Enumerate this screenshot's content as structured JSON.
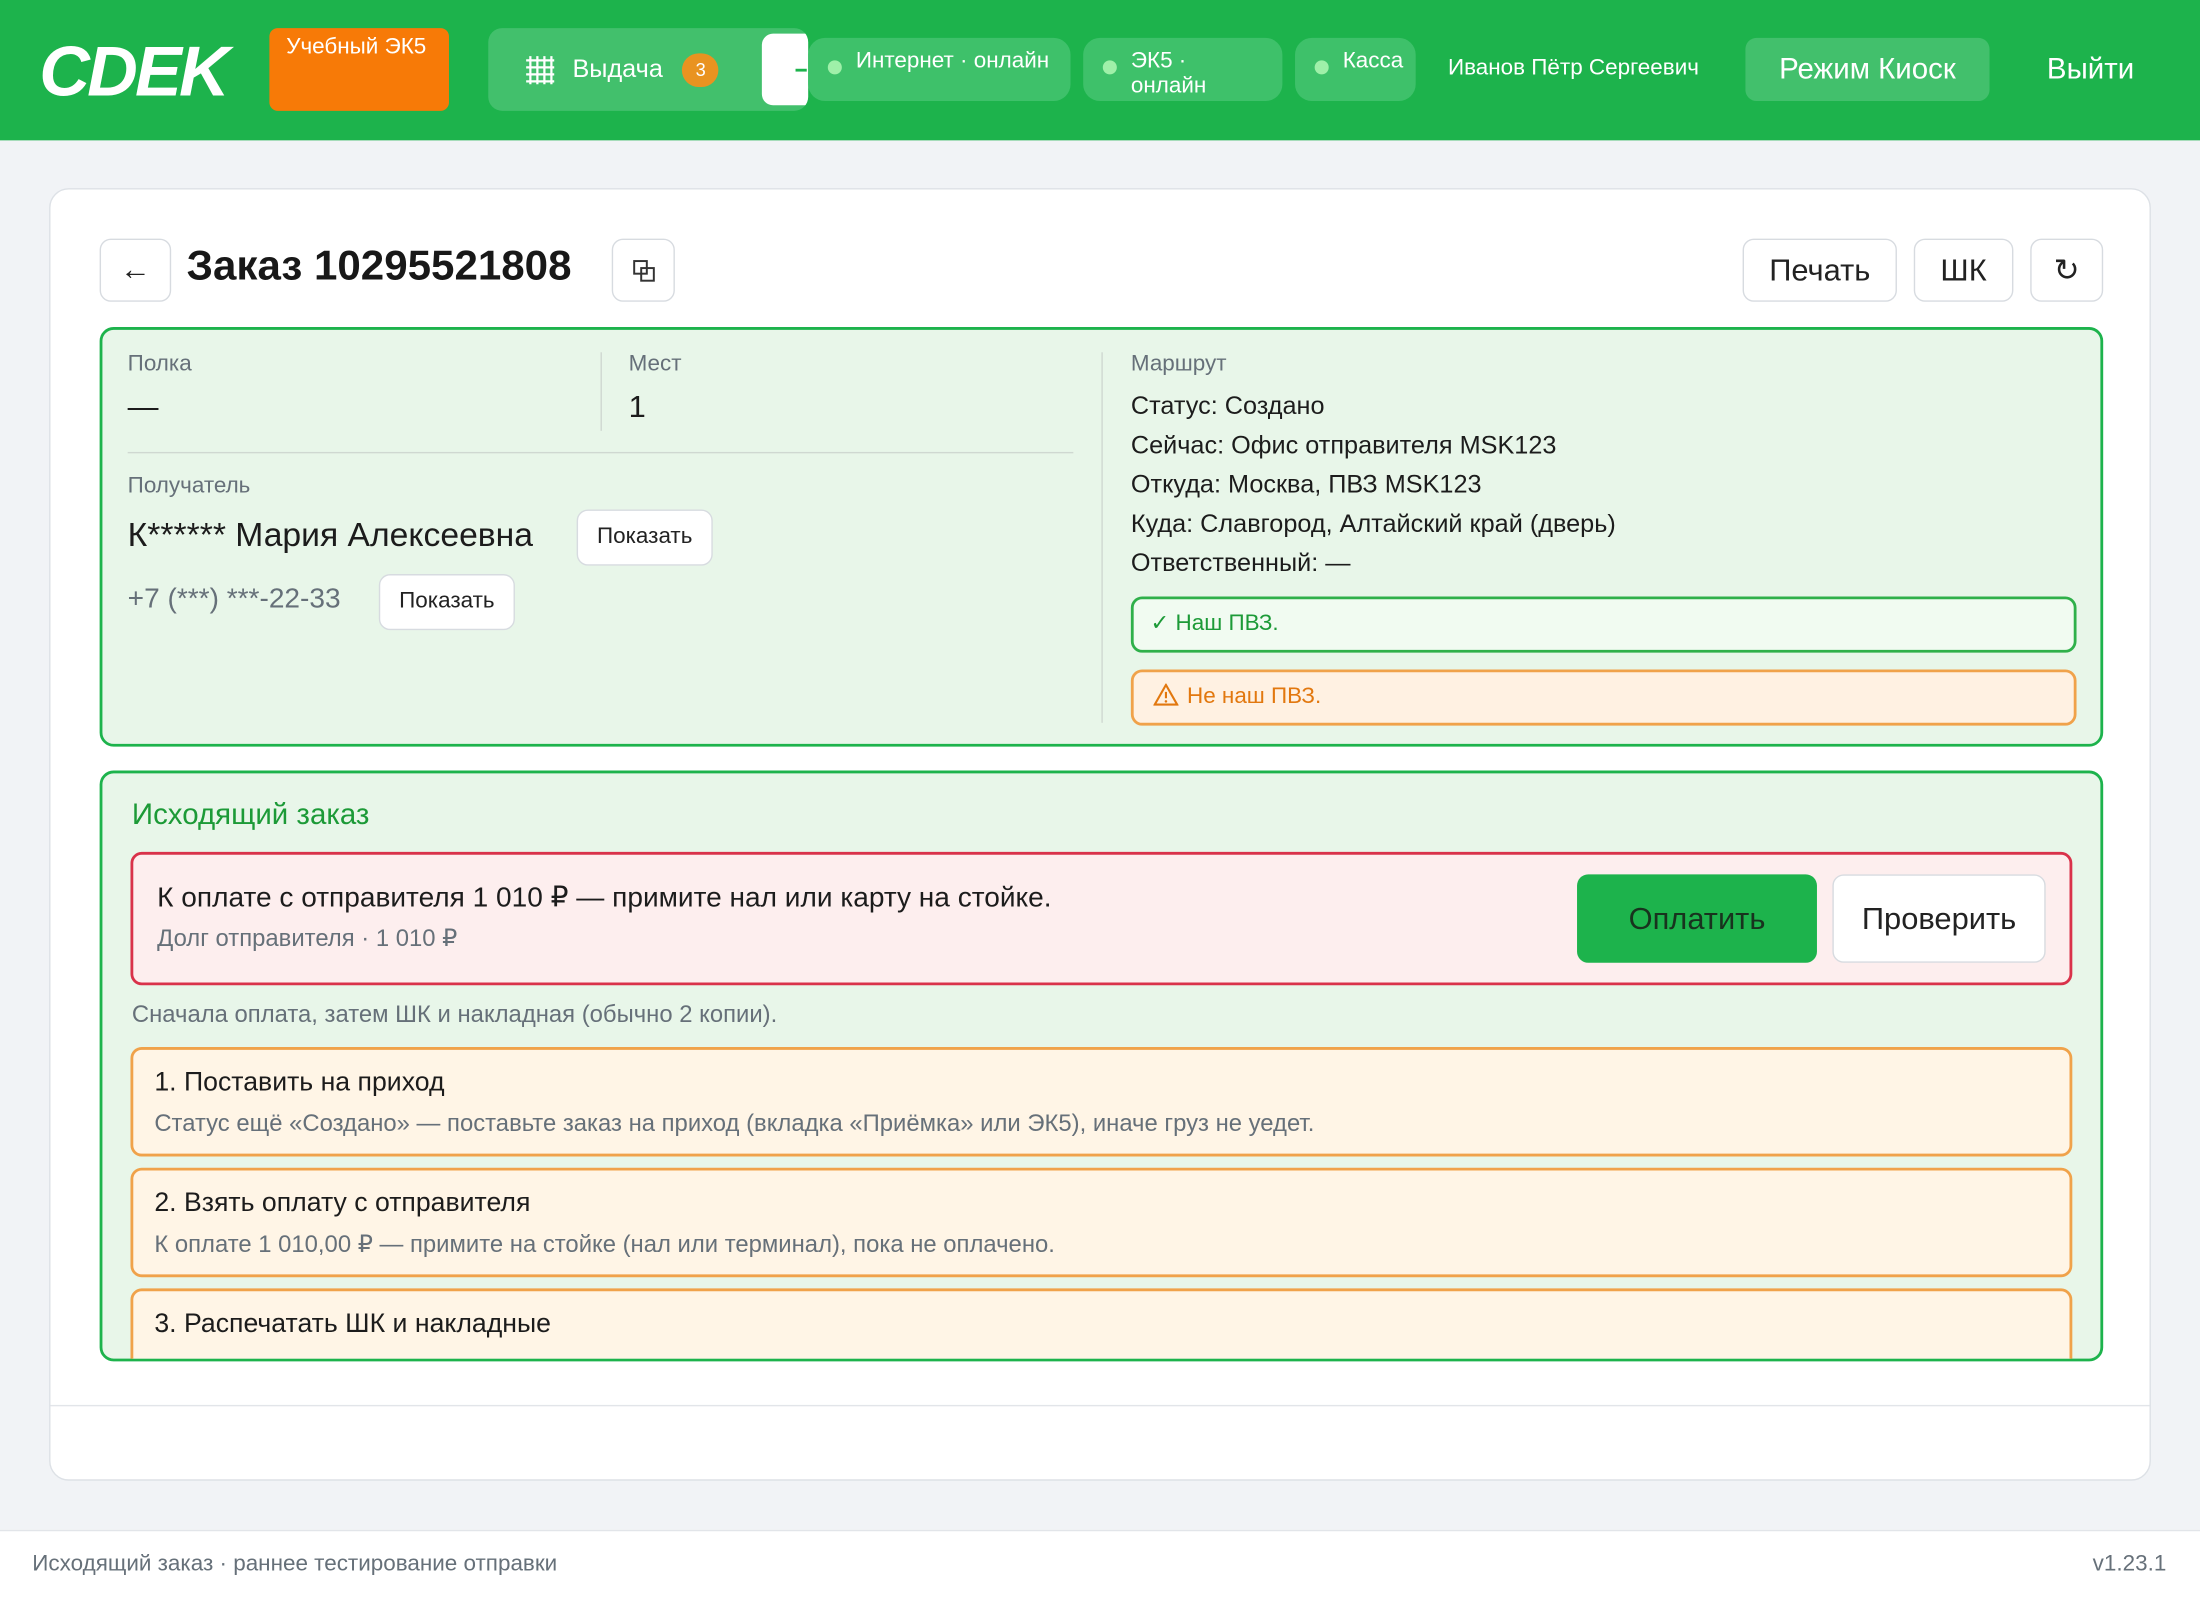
{
  "header": {
    "logo_text": "CDEK",
    "edu_badge": "Учебный ЭК5",
    "tab_vydacha": "Выдача",
    "tab_vydacha_count": "3",
    "status_internet": "Интернет · онлайн",
    "status_ek5": "ЭК5 · онлайн",
    "status_kassa": "Касса",
    "user_name": "Иванов Пётр Сергеевич",
    "kiosk_label": "Режим Киоск",
    "logout_label": "Выйти",
    "accent_color": "#1db34c",
    "edu_color": "#f77a07"
  },
  "order": {
    "back_label": "←",
    "title": "Заказ 10295521808",
    "print_label": "Печать",
    "barcode_label": "ШК",
    "refresh_label": "↻",
    "shelf_label": "Полка",
    "shelf_value": "—",
    "places_label": "Мест",
    "places_value": "1",
    "recipient_label": "Получатель",
    "recipient_name": "К****** Мария Алексеевна",
    "recipient_show": "Показать",
    "phone": "+7 (***) ***-22-33",
    "phone_show": "Показать",
    "route_label": "Маршрут",
    "route": {
      "status": "Статус:  Создано",
      "now": "Сейчас:  Офис отправителя MSK123",
      "from": "Откуда:  Москва, ПВЗ MSK123",
      "to": "Куда:  Славгород, Алтайский край (дверь)",
      "responsible": "Ответственный:  —"
    },
    "pvz_ok": "✓ Наш ПВЗ.",
    "pvz_warn": "Не наш ПВЗ."
  },
  "outgoing": {
    "title": "Исходящий заказ",
    "pay_main": "К оплате с отправителя 1 010 ₽ — примите нал или карту на стойке.",
    "pay_sub": "Долг отправителя · 1 010 ₽",
    "pay_btn": "Оплатить",
    "check_btn": "Проверить",
    "hint": "Сначала оплата, затем ШК и накладная (обычно 2 копии).",
    "steps": [
      {
        "title": "1. Поставить на приход",
        "desc": "Статус ещё «Создано» — поставьте заказ на приход (вкладка «Приёмка» или ЭК5), иначе груз не уедет."
      },
      {
        "title": "2. Взять оплату с отправителя",
        "desc": "К оплате 1 010,00 ₽ — примите на стойке (нал или терминал), пока не оплачено."
      },
      {
        "title": "3. Распечатать ШК и накладные",
        "desc": ""
      }
    ]
  },
  "footer": {
    "left": "Исходящий заказ · раннее тестирование отправки",
    "right": "v1.23.1"
  }
}
